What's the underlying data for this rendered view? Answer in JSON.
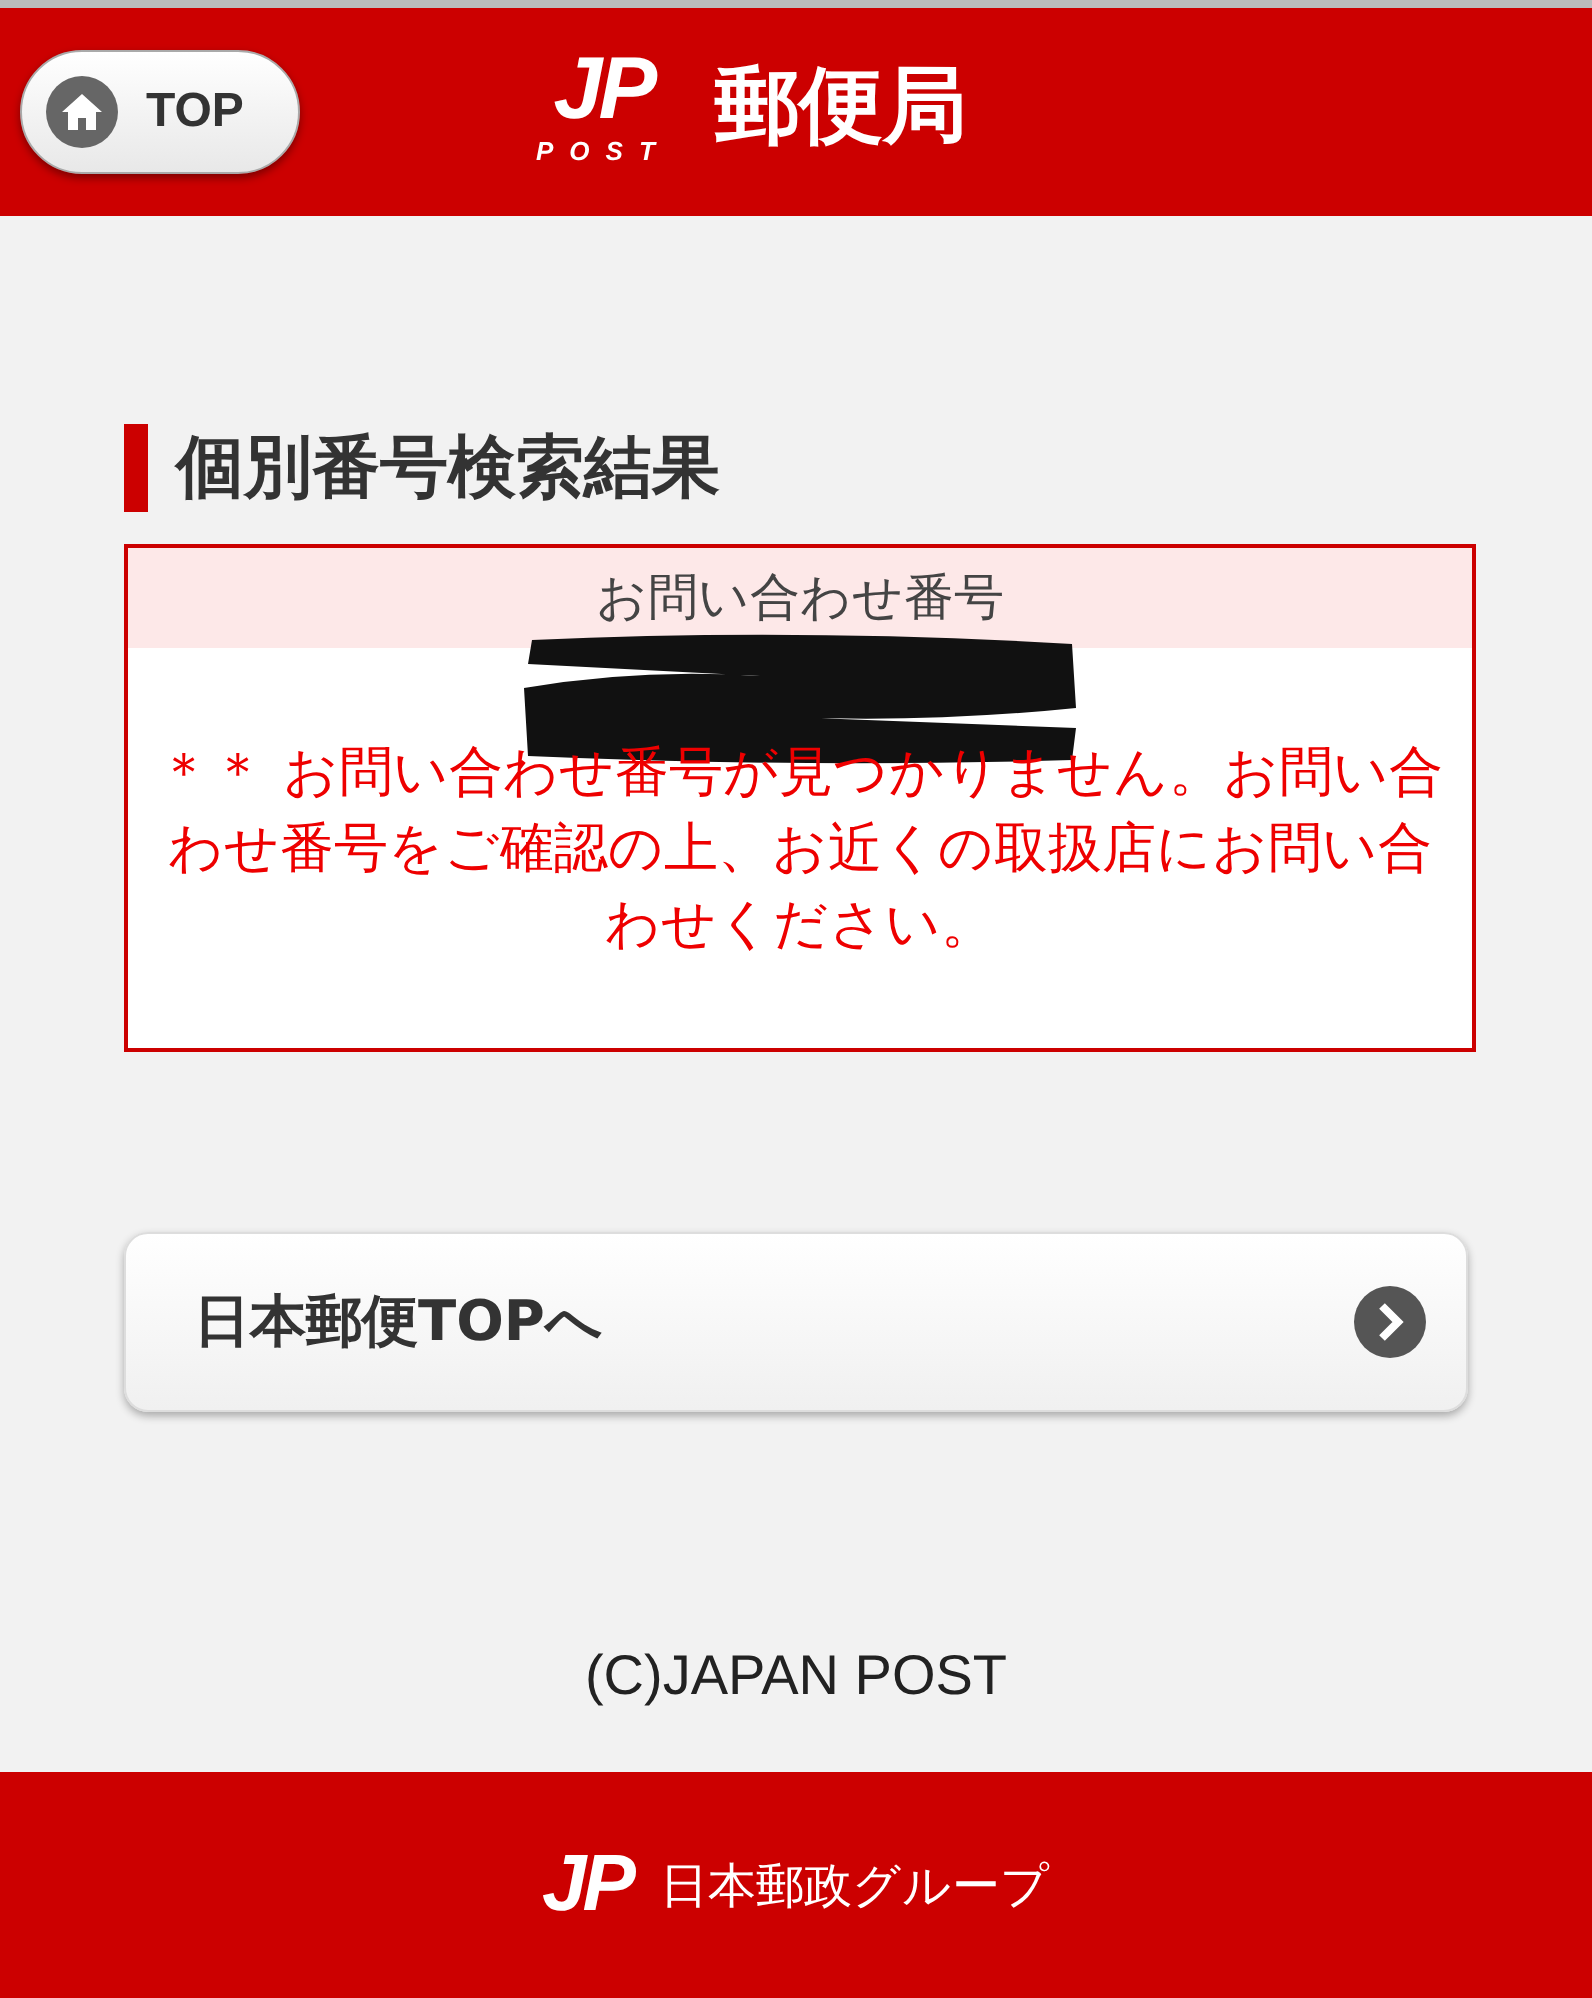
{
  "header": {
    "top_button": "TOP",
    "logo": {
      "mark": "JP",
      "sub": "POST"
    },
    "title": "郵便局"
  },
  "heading": "個別番号検索結果",
  "result": {
    "label": "お問い合わせ番号",
    "number_redacted": true,
    "message": "＊＊ お問い合わせ番号が見つかりません。お問い合わせ番号をご確認の上、お近くの取扱店にお問い合わせください。"
  },
  "link_button": "日本郵便TOPへ",
  "copyright": "(C)JAPAN POST",
  "footer": {
    "logo": {
      "mark": "JP"
    },
    "group_name": "日本郵政グループ"
  }
}
